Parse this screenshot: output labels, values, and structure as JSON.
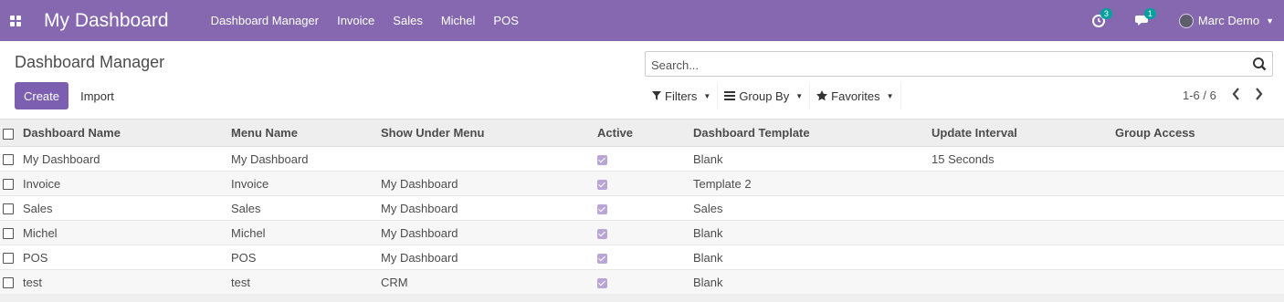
{
  "navbar": {
    "brand": "My Dashboard",
    "menu": [
      "Dashboard Manager",
      "Invoice",
      "Sales",
      "Michel",
      "POS"
    ],
    "activity_count": "3",
    "messages_count": "1",
    "user_name": "Marc Demo"
  },
  "control_panel": {
    "breadcrumb": "Dashboard Manager",
    "search_placeholder": "Search...",
    "create_label": "Create",
    "import_label": "Import",
    "filters_label": "Filters",
    "group_by_label": "Group By",
    "favorites_label": "Favorites",
    "pager_value": "1-6 / 6"
  },
  "table": {
    "columns": [
      "Dashboard Name",
      "Menu Name",
      "Show Under Menu",
      "Active",
      "Dashboard Template",
      "Update Interval",
      "Group Access"
    ],
    "rows": [
      {
        "name": "My Dashboard",
        "menu": "My Dashboard",
        "under": "",
        "active": true,
        "template": "Blank",
        "interval": "15 Seconds",
        "group": ""
      },
      {
        "name": "Invoice",
        "menu": "Invoice",
        "under": "My Dashboard",
        "active": true,
        "template": "Template 2",
        "interval": "",
        "group": ""
      },
      {
        "name": "Sales",
        "menu": "Sales",
        "under": "My Dashboard",
        "active": true,
        "template": "Sales",
        "interval": "",
        "group": ""
      },
      {
        "name": "Michel",
        "menu": "Michel",
        "under": "My Dashboard",
        "active": true,
        "template": "Blank",
        "interval": "",
        "group": ""
      },
      {
        "name": "POS",
        "menu": "POS",
        "under": "My Dashboard",
        "active": true,
        "template": "Blank",
        "interval": "",
        "group": ""
      },
      {
        "name": "test",
        "menu": "test",
        "under": "CRM",
        "active": true,
        "template": "Blank",
        "interval": "",
        "group": ""
      }
    ]
  },
  "colors": {
    "navbar": "#8568b0",
    "create_button": "#7c5fb0",
    "badge": "#00a09d",
    "checkbox_active": "#b9a6d6"
  },
  "icons": [
    "apps-icon",
    "activity-clock-icon",
    "chat-icon",
    "avatar",
    "search-icon",
    "filter-icon",
    "group-by-icon",
    "star-icon",
    "chevron-left-icon",
    "chevron-right-icon"
  ]
}
